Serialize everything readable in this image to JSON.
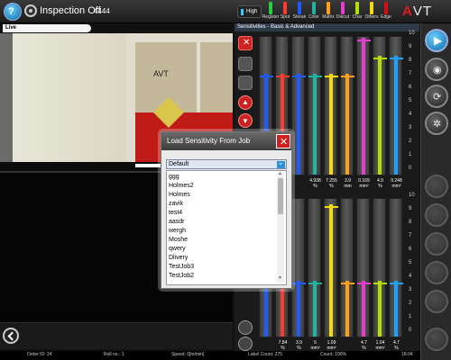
{
  "topbar": {
    "status_label": "Inspection Off",
    "job_number": "4444",
    "level_label": "High",
    "categories": [
      {
        "label": "Register",
        "color": "#2ecc40"
      },
      {
        "label": "Spot",
        "color": "#ff3b30"
      },
      {
        "label": "Streak",
        "color": "#1e5bff"
      },
      {
        "label": "Color",
        "color": "#1fb5a0"
      },
      {
        "label": "Matrix",
        "color": "#ff9f1a"
      },
      {
        "label": "Diecut",
        "color": "#e63ccf"
      },
      {
        "label": "Char",
        "color": "#b4e000"
      },
      {
        "label": "Others",
        "color": "#f5d90a"
      },
      {
        "label": "Edge",
        "color": "#d40f0f"
      }
    ],
    "brand_prefix": "A",
    "brand_suffix": "VT"
  },
  "live": {
    "tab_label": "Live"
  },
  "sensitivities": {
    "title": "Sensitivities - Basic & Advanced",
    "scale": [
      "10",
      "9",
      "8",
      "7",
      "6",
      "5",
      "4",
      "3",
      "2",
      "1",
      "0"
    ],
    "upper_values": [
      {
        "value": "",
        "unit": ""
      },
      {
        "value": "",
        "unit": ""
      },
      {
        "value": "4.938",
        "unit": "%"
      },
      {
        "value": "7.255",
        "unit": "%"
      },
      {
        "value": "3.9",
        "unit": "mm"
      },
      {
        "value": "0.169",
        "unit": "mm²"
      },
      {
        "value": "4.9",
        "unit": "%"
      },
      {
        "value": "0.248",
        "unit": "mm²"
      }
    ],
    "lower_values": [
      {
        "value": "7.84",
        "unit": "%"
      },
      {
        "value": "3.9",
        "unit": "%"
      },
      {
        "value": "5",
        "unit": "mm²"
      },
      {
        "value": "1.09",
        "unit": "mm²"
      },
      {
        "value": "",
        "unit": ""
      },
      {
        "value": "4.7",
        "unit": "%"
      },
      {
        "value": "1.04",
        "unit": "mm²"
      },
      {
        "value": "4.7",
        "unit": "%"
      }
    ]
  },
  "dialog": {
    "title": "Load Sensitivity From Job",
    "selected": "Default",
    "items": [
      "ggg",
      "Holmes2",
      "Holmes",
      "zavik",
      "test4",
      "aasdr",
      "wergh",
      "Moshe",
      "qwery",
      "Dlivery",
      "TestJob3",
      "TestJob2"
    ]
  },
  "status_bar": {
    "order": "Order ID: 24",
    "roll": "Roll no.: 1",
    "speed": "Speed: 0[m/min]",
    "label_count": "Label Count: 275",
    "count2": "Count: 100%",
    "clock": "18:04"
  }
}
